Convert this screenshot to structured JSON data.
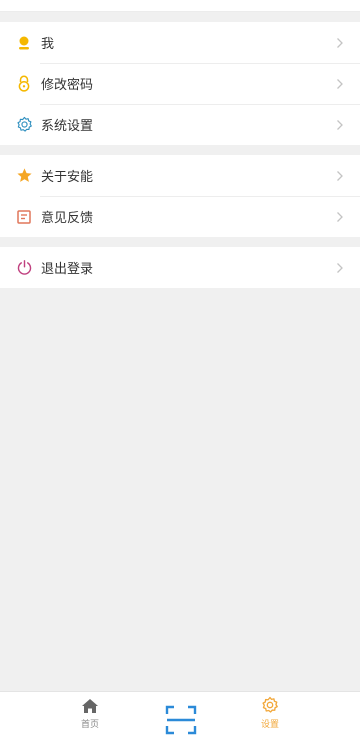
{
  "menu": {
    "group1": [
      {
        "label": "我",
        "icon": "user-icon"
      },
      {
        "label": "修改密码",
        "icon": "lock-icon"
      },
      {
        "label": "系统设置",
        "icon": "gear-icon"
      }
    ],
    "group2": [
      {
        "label": "关于安能",
        "icon": "star-icon"
      },
      {
        "label": "意见反馈",
        "icon": "feedback-icon"
      }
    ],
    "group3": [
      {
        "label": "退出登录",
        "icon": "power-icon"
      }
    ]
  },
  "tabbar": {
    "home_label": "首页",
    "scan_icon": "scan-icon",
    "settings_label": "设置"
  },
  "colors": {
    "accent": "#f2a83b",
    "scan_blue": "#2b8ad8",
    "logout_pink": "#c0407f",
    "star": "#f5a623",
    "gear": "#2f8fbf",
    "feedback": "#e0765a"
  }
}
